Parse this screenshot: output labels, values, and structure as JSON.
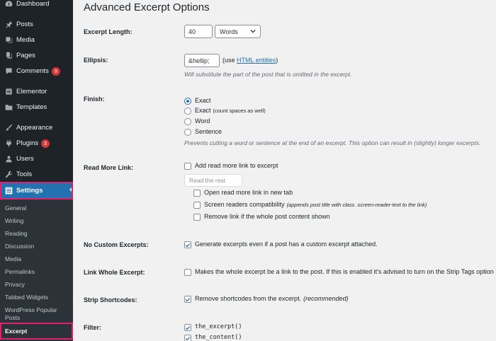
{
  "sidebar": {
    "items": [
      {
        "label": "Dashboard",
        "icon": "dashboard-icon"
      },
      {
        "label": "Posts",
        "icon": "pin-icon"
      },
      {
        "label": "Media",
        "icon": "media-icon"
      },
      {
        "label": "Pages",
        "icon": "pages-icon"
      },
      {
        "label": "Comments",
        "icon": "comment-icon",
        "badge": "9"
      },
      {
        "label": "Elementor",
        "icon": "elementor-icon"
      },
      {
        "label": "Templates",
        "icon": "folder-icon"
      },
      {
        "label": "Appearance",
        "icon": "paintbrush-icon"
      },
      {
        "label": "Plugins",
        "icon": "plugin-icon",
        "badge": "5"
      },
      {
        "label": "Users",
        "icon": "users-icon"
      },
      {
        "label": "Tools",
        "icon": "wrench-icon"
      },
      {
        "label": "Settings",
        "icon": "settings-icon"
      }
    ],
    "submenu": [
      "General",
      "Writing",
      "Reading",
      "Discussion",
      "Media",
      "Permalinks",
      "Privacy",
      "Tabbed Widgets",
      "WordPress Popular Posts",
      "Excerpt"
    ]
  },
  "page": {
    "title": "Advanced Excerpt Options"
  },
  "excerpt_length": {
    "label": "Excerpt Length:",
    "value": "40",
    "unit": "Words"
  },
  "ellipsis": {
    "label": "Ellipsis:",
    "value": "&hellip;",
    "use_prefix": "(use",
    "link": "HTML entities",
    "use_suffix": ")",
    "hint": "Will substitute the part of the post that is omitted in the excerpt."
  },
  "finish": {
    "label": "Finish:",
    "options": [
      {
        "label": "Exact",
        "note": "",
        "checked": true
      },
      {
        "label": "Exact",
        "note": "(count spaces as well)",
        "checked": false
      },
      {
        "label": "Word",
        "note": "",
        "checked": false
      },
      {
        "label": "Sentence",
        "note": "",
        "checked": false
      }
    ],
    "hint": "Prevents cutting a word or sentence at the end of an excerpt. This option can result in (slightly) longer excerpts."
  },
  "read_more": {
    "label": "Read More Link:",
    "add_label": "Add read more link to excerpt",
    "placeholder": "Read the rest",
    "options": [
      {
        "label": "Open read more link in new tab",
        "note": ""
      },
      {
        "label": "Screen readers compatibility",
        "note": "(appends post title with class .screen-reader-text to the link)"
      },
      {
        "label": "Remove link if the whole post content shown",
        "note": ""
      }
    ]
  },
  "no_custom": {
    "label": "No Custom Excerpts:",
    "text": "Generate excerpts even if a post has a custom excerpt attached."
  },
  "link_whole": {
    "label": "Link Whole Excerpt:",
    "text": "Makes the whole excerpt be a link to the post. If this is enabled it's advised to turn on the Strip Tags option"
  },
  "strip_shortcodes": {
    "label": "Strip Shortcodes:",
    "text": "Remove shortcodes from the excerpt.",
    "note": "(recommended)"
  },
  "filter": {
    "label": "Filter:",
    "options": [
      "the_excerpt()",
      "the_content()"
    ]
  },
  "colors": {
    "sidebar_bg": "#1d2327",
    "accent": "#2271b1",
    "highlight": "#e0226e",
    "badge": "#d63638"
  }
}
